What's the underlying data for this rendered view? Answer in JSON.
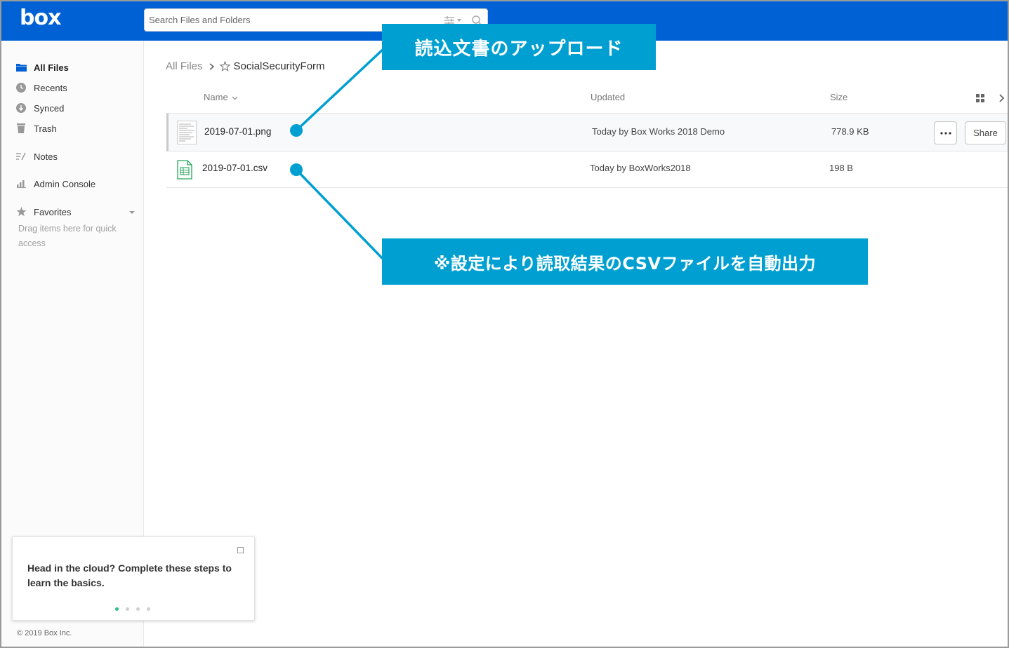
{
  "header": {
    "logo": "box",
    "search_placeholder": "Search Files and Folders"
  },
  "sidebar": {
    "items": [
      {
        "label": "All Files",
        "icon": "folder-icon",
        "active": true
      },
      {
        "label": "Recents",
        "icon": "clock-icon"
      },
      {
        "label": "Synced",
        "icon": "sync-icon"
      },
      {
        "label": "Trash",
        "icon": "trash-icon"
      },
      {
        "label": "Notes",
        "icon": "notes-icon"
      },
      {
        "label": "Admin Console",
        "icon": "bar-chart-icon"
      },
      {
        "label": "Favorites",
        "icon": "star-icon"
      }
    ],
    "favorites_hint": "Drag items here for quick access",
    "tip_card": {
      "text": "Head in the cloud? Complete these steps to learn the basics.",
      "steps_total": 4,
      "active_step": 1
    },
    "copyright": "© 2019 Box Inc."
  },
  "breadcrumb": {
    "root": "All Files",
    "current": "SocialSecurityForm"
  },
  "columns": {
    "name": "Name",
    "updated": "Updated",
    "size": "Size"
  },
  "files": [
    {
      "name": "2019-07-01.png",
      "updated": "Today by Box Works 2018 Demo",
      "size": "778.9 KB",
      "type": "image"
    },
    {
      "name": "2019-07-01.csv",
      "updated": "Today by BoxWorks2018",
      "size": "198 B",
      "type": "spreadsheet"
    }
  ],
  "row_actions": {
    "share": "Share"
  },
  "callouts": {
    "upload": "読込文書のアップロード",
    "csv_output": "※設定により読取結果のCSVファイルを自動出力"
  },
  "colors": {
    "header": "#0061d5",
    "callout": "#009fd1",
    "csv_icon": "#26a65b"
  }
}
